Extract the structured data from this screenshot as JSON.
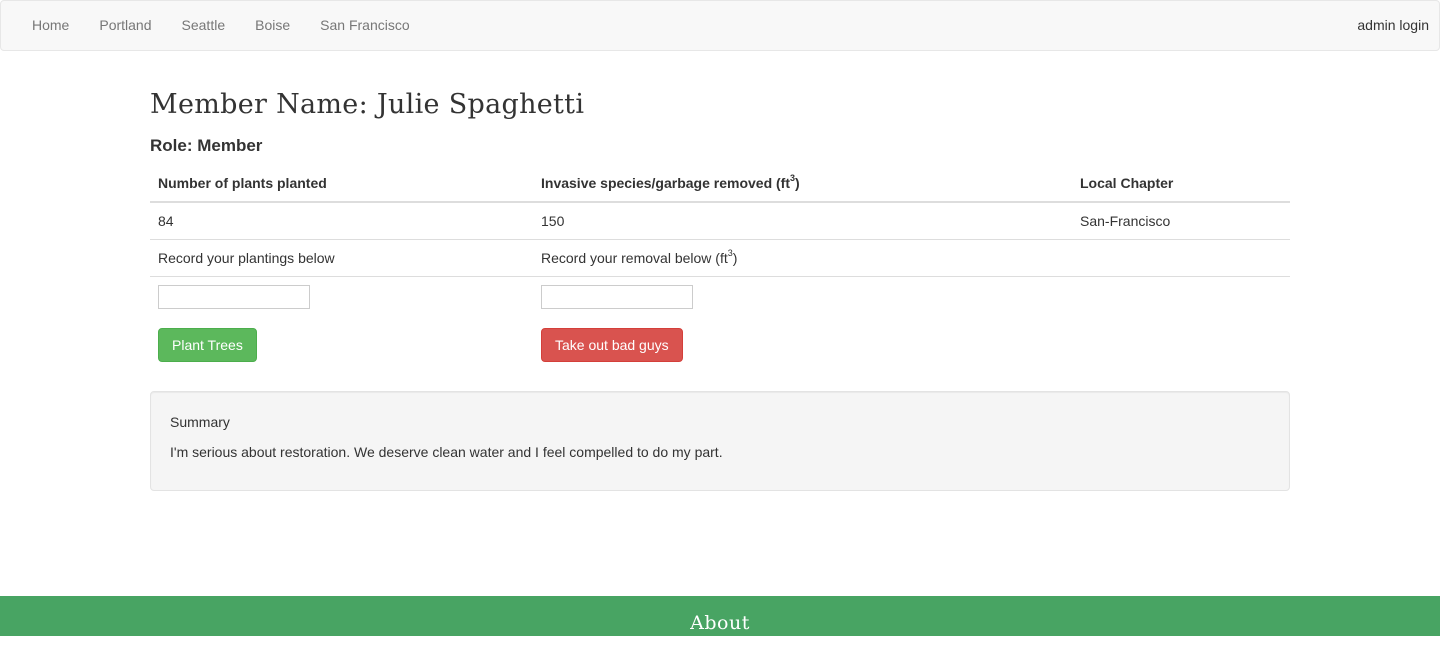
{
  "nav": {
    "links": [
      "Home",
      "Portland",
      "Seattle",
      "Boise",
      "San Francisco"
    ],
    "admin_label": "admin login"
  },
  "member": {
    "title": "Member Name: Julie Spaghetti",
    "role": "Role: Member"
  },
  "table": {
    "headers": {
      "plants": "Number of plants planted",
      "removed": "Invasive species/garbage removed (ft",
      "removed_sup": "3",
      "removed_close": ")",
      "chapter": "Local Chapter"
    },
    "values": {
      "plants": "84",
      "removed": "150",
      "chapter": "San-Francisco"
    },
    "prompts": {
      "plantings": "Record your plantings below",
      "removal": "Record your removal below (ft",
      "removal_sup": "3",
      "removal_close": ")"
    },
    "inputs": {
      "plantings_value": "",
      "removal_value": ""
    },
    "buttons": {
      "plant": "Plant Trees",
      "remove": "Take out bad guys"
    }
  },
  "summary": {
    "title": "Summary",
    "text": "I'm serious about restoration. We deserve clean water and I feel compelled to do my part."
  },
  "footer": {
    "title": "About"
  },
  "colors": {
    "footer_bg": "#48a463",
    "success": "#5cb85c",
    "danger": "#d9534f",
    "navbar_bg": "#f8f8f8"
  }
}
